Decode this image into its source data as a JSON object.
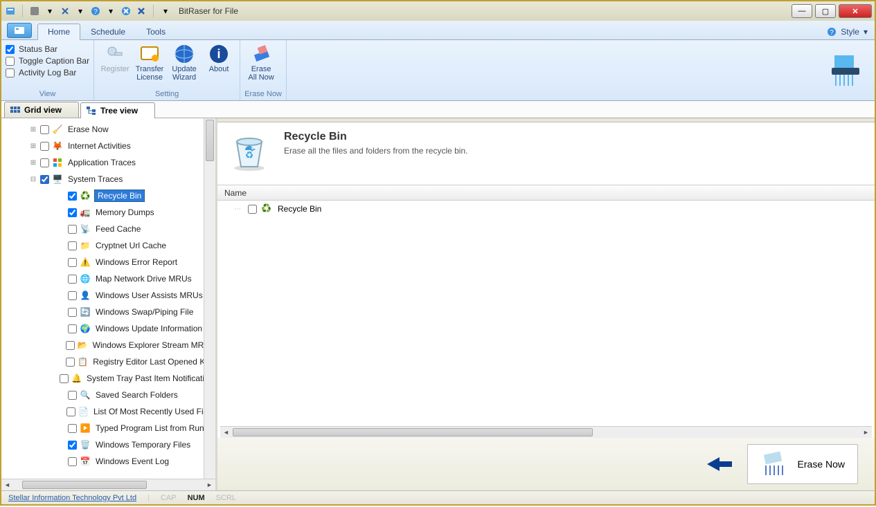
{
  "window": {
    "title": "BitRaser for File"
  },
  "tabs": {
    "home": "Home",
    "schedule": "Schedule",
    "tools": "Tools",
    "style": "Style"
  },
  "ribbon": {
    "view": {
      "status_bar": "Status Bar",
      "toggle_caption": "Toggle Caption Bar",
      "activity_log": "Activity Log Bar",
      "label": "View"
    },
    "setting": {
      "register": "Register",
      "transfer1": "Transfer",
      "transfer2": "License",
      "update1": "Update",
      "update2": "Wizard",
      "about": "About",
      "label": "Setting"
    },
    "erase_now": {
      "erase1": "Erase",
      "erase2": "All Now",
      "label": "Erase Now"
    }
  },
  "view_tabs": {
    "grid": "Grid view",
    "tree": "Tree view"
  },
  "tree": {
    "erase_now": "Erase Now",
    "internet": "Internet Activities",
    "app_traces": "Application Traces",
    "system_traces": "System Traces",
    "items": [
      "Recycle Bin",
      "Memory Dumps",
      "Feed Cache",
      "Cryptnet Url Cache",
      "Windows Error Report",
      "Map Network Drive MRUs",
      "Windows User Assists MRUs",
      "Windows Swap/Piping File",
      "Windows Update Information",
      "Windows Explorer Stream MRUs",
      "Registry Editor Last Opened Key",
      "System Tray Past Item Notifications",
      "Saved Search Folders",
      "List Of Most Recently Used Files",
      "Typed Program List from Run",
      "Windows Temporary Files",
      "Windows Event Log"
    ]
  },
  "content": {
    "title": "Recycle Bin",
    "subtitle": "Erase all the files and folders from the recycle bin.",
    "col_name": "Name",
    "row0": "Recycle Bin"
  },
  "action": {
    "erase_now": "Erase Now"
  },
  "status": {
    "link": "Stellar Information Technology Pvt Ltd",
    "cap": "CAP",
    "num": "NUM",
    "scrl": "SCRL"
  }
}
